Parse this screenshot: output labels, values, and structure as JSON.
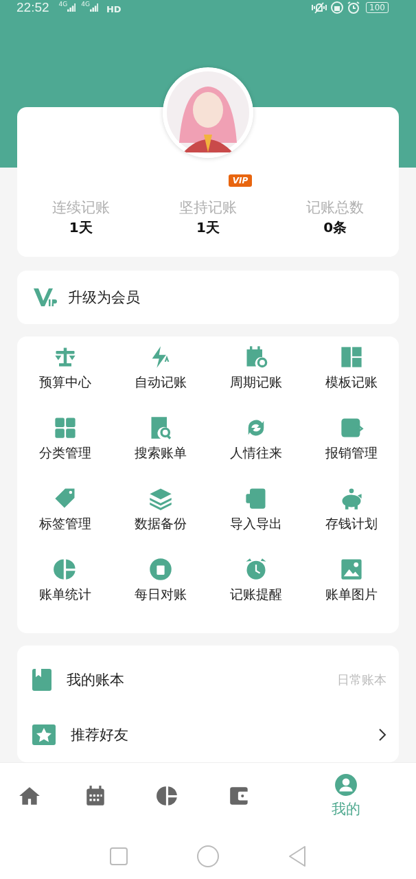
{
  "status_bar": {
    "time": "22:52",
    "signals": [
      "4G",
      "4G"
    ],
    "hd": "HD",
    "battery": "100"
  },
  "profile": {
    "vip_badge": "VIP",
    "stats": [
      {
        "label": "连续记账",
        "value": "1天"
      },
      {
        "label": "坚持记账",
        "value": "1天"
      },
      {
        "label": "记账总数",
        "value": "0条"
      }
    ]
  },
  "upgrade": {
    "label": "升级为会员"
  },
  "features": [
    {
      "label": "预算中心"
    },
    {
      "label": "自动记账"
    },
    {
      "label": "周期记账"
    },
    {
      "label": "模板记账"
    },
    {
      "label": "分类管理"
    },
    {
      "label": "搜索账单"
    },
    {
      "label": "人情往来"
    },
    {
      "label": "报销管理"
    },
    {
      "label": "标签管理"
    },
    {
      "label": "数据备份"
    },
    {
      "label": "导入导出"
    },
    {
      "label": "存钱计划"
    },
    {
      "label": "账单统计"
    },
    {
      "label": "每日对账"
    },
    {
      "label": "记账提醒"
    },
    {
      "label": "账单图片"
    }
  ],
  "menu": [
    {
      "kind": "value",
      "label": "我的账本",
      "value": "日常账本"
    },
    {
      "kind": "link",
      "label": "推荐好友"
    }
  ],
  "bottom_nav": [
    {
      "selected": false
    },
    {
      "selected": false
    },
    {
      "selected": false
    },
    {
      "selected": false
    },
    {
      "selected": true,
      "label": "我的"
    }
  ]
}
